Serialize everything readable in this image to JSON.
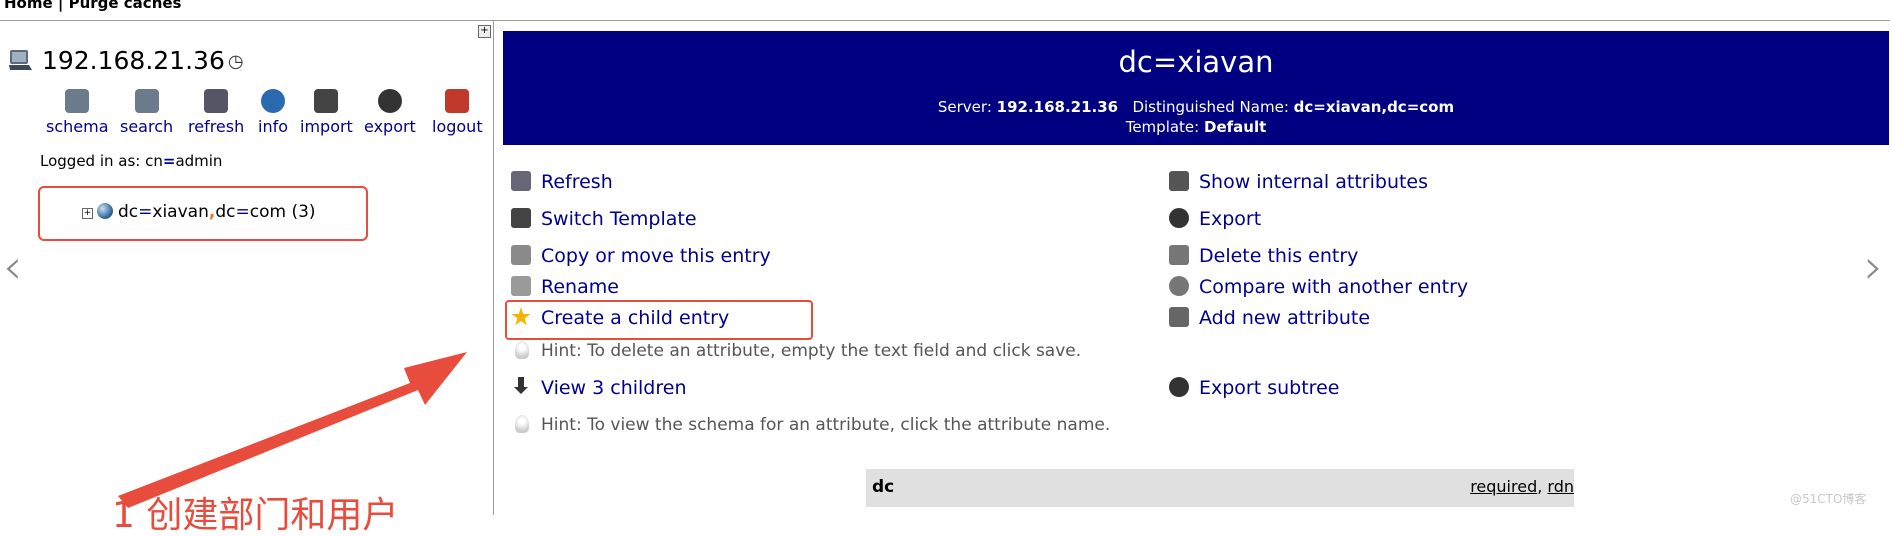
{
  "topbar": {
    "text": "Home | Purge caches"
  },
  "left": {
    "expand_glyph": "+",
    "server": "192.168.21.36",
    "clock_glyph": "◷",
    "tools": [
      {
        "name": "schema",
        "icon": "schema-icon",
        "color": "#6b7b8c"
      },
      {
        "name": "search",
        "icon": "search-icon",
        "color": "#6b7b8c"
      },
      {
        "name": "refresh",
        "icon": "refresh-icon",
        "color": "#556"
      },
      {
        "name": "info",
        "icon": "info-icon",
        "color": "#2a6ab0"
      },
      {
        "name": "import",
        "icon": "import-icon",
        "color": "#444"
      },
      {
        "name": "export",
        "icon": "export-icon",
        "color": "#333"
      },
      {
        "name": "logout",
        "icon": "logout-icon",
        "color": "#c0392b"
      }
    ],
    "logged_prefix": "Logged in as: cn",
    "logged_eq": "=",
    "logged_user": "admin",
    "tree_count": "(3)",
    "tree_part1": "dc",
    "tree_eq1": "=",
    "tree_part2": "xiavan",
    "tree_comma": ",",
    "tree_part3": "dc",
    "tree_eq2": "=",
    "tree_part4": "com"
  },
  "nav": {
    "left": "‹",
    "right": "›"
  },
  "main": {
    "title": "dc=xiavan",
    "server_label": "Server:",
    "server_value": "192.168.21.36",
    "dn_label": "Distinguished Name:",
    "dn_value": "dc=xiavan,dc=com",
    "template_label": "Template:",
    "template_value": "Default",
    "actions_left": [
      "Refresh",
      "Switch Template",
      "Copy or move this entry",
      "Rename",
      "Create a child entry"
    ],
    "actions_right": [
      "Show internal attributes",
      "Export",
      "Delete this entry",
      "Compare with another entry",
      "Add new attribute"
    ],
    "hint1": "Hint: To delete an attribute, empty the text field and click save.",
    "view_children": "View 3 children",
    "export_subtree": "Export subtree",
    "hint2": "Hint: To view the schema for an attribute, click the attribute name.",
    "attr_name": "dc",
    "attr_required": "required",
    "attr_sep": ", ",
    "attr_rdn": "rdn"
  },
  "annotation": {
    "text": "1 创建部门和用户",
    "color": "#e74c3c"
  },
  "watermark": "@51CTO博客",
  "colors": {
    "header_bg": "#000080",
    "link": "#00008b",
    "highlight": "#e74c3c"
  }
}
